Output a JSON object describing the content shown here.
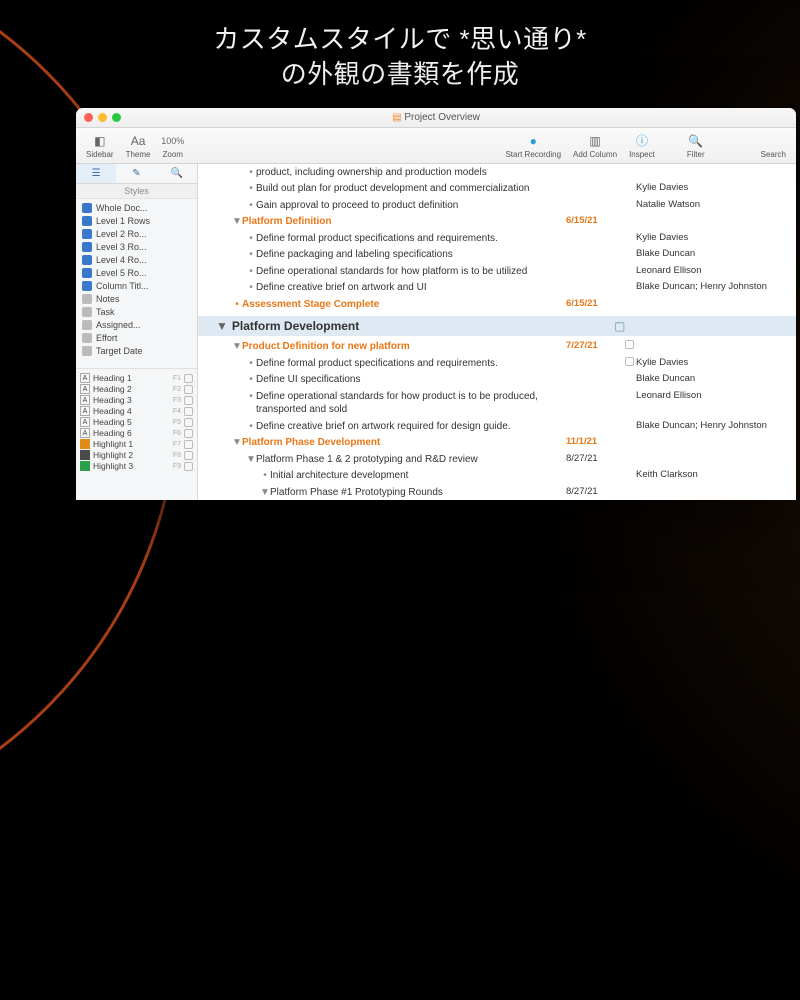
{
  "headline_line1": "カスタムスタイルで *思い通り*",
  "headline_line2": "の外観の書類を作成",
  "window": {
    "title": "Project Overview"
  },
  "toolbar": {
    "sidebar": "Sidebar",
    "theme": "Theme",
    "zoom_pct": "100%",
    "zoom": "Zoom",
    "start_rec": "Start Recording",
    "add_col": "Add Column",
    "inspect": "Inspect",
    "filter": "Filter",
    "search": "Search"
  },
  "sidebar": {
    "styles_header": "Styles",
    "styles": [
      {
        "label": "Whole Doc...",
        "blue": true
      },
      {
        "label": "Level 1 Rows",
        "blue": true
      },
      {
        "label": "Level 2 Ro...",
        "blue": true
      },
      {
        "label": "Level 3 Ro...",
        "blue": true
      },
      {
        "label": "Level 4 Ro...",
        "blue": true
      },
      {
        "label": "Level 5 Ro...",
        "blue": true
      },
      {
        "label": "Column Titl...",
        "blue": true
      },
      {
        "label": "Notes",
        "blue": false
      },
      {
        "label": "Task",
        "blue": false
      },
      {
        "label": "Assigned...",
        "blue": false
      },
      {
        "label": "Effort",
        "blue": false
      },
      {
        "label": "Target Date",
        "blue": false
      }
    ],
    "formats": [
      {
        "label": "Heading 1",
        "key": "F1",
        "type": "H"
      },
      {
        "label": "Heading 2",
        "key": "F2",
        "type": "H"
      },
      {
        "label": "Heading 3",
        "key": "F3",
        "type": "H"
      },
      {
        "label": "Heading 4",
        "key": "F4",
        "type": "H"
      },
      {
        "label": "Heading 5",
        "key": "F5",
        "type": "H"
      },
      {
        "label": "Heading 6",
        "key": "F6",
        "type": "H"
      },
      {
        "label": "Highlight 1",
        "key": "F7",
        "type": "HL",
        "color": "#e08a1a"
      },
      {
        "label": "Highlight 2",
        "key": "F8",
        "type": "HL",
        "color": "#4a4a4a"
      },
      {
        "label": "Highlight 3",
        "key": "F9",
        "type": "HL",
        "color": "#2aa04a"
      }
    ]
  },
  "outline": {
    "section_title": "Platform Development",
    "rows": [
      {
        "indent": 1,
        "type": "bullet",
        "text": "product, including ownership and production models",
        "date": "",
        "assignee": ""
      },
      {
        "indent": 1,
        "type": "bullet",
        "text": "Build out plan for product development and commercialization",
        "date": "",
        "assignee": "Kylie Davies"
      },
      {
        "indent": 1,
        "type": "bullet",
        "text": "Gain approval to proceed to product definition",
        "date": "",
        "assignee": "Natalie Watson"
      },
      {
        "indent": 0,
        "type": "tri",
        "orange": true,
        "text": "Platform Definition",
        "date": "6/15/21",
        "assignee": ""
      },
      {
        "indent": 1,
        "type": "bullet",
        "text": "Define formal product specifications and requirements.",
        "date": "",
        "assignee": "Kylie Davies"
      },
      {
        "indent": 1,
        "type": "bullet",
        "text": "Define packaging and labeling specifications",
        "date": "",
        "assignee": "Blake Duncan"
      },
      {
        "indent": 1,
        "type": "bullet",
        "text": "Define operational standards for how platform is to be utilized",
        "date": "",
        "assignee": "Leonard Ellison"
      },
      {
        "indent": 1,
        "type": "bullet",
        "text": "Define creative brief on artwork and UI",
        "date": "",
        "assignee": "Blake Duncan; Henry Johnston"
      },
      {
        "indent": 0,
        "type": "dot",
        "orange": true,
        "text": "Assessment Stage Complete",
        "date": "6/15/21",
        "assignee": ""
      }
    ],
    "rows2": [
      {
        "indent": 0,
        "type": "tri",
        "orange": true,
        "text": "Product Definition for new platform",
        "date": "7/27/21",
        "assignee": "",
        "check": true
      },
      {
        "indent": 1,
        "type": "bullet",
        "text": "Define formal product specifications and requirements.",
        "date": "",
        "assignee": "Kylie Davies",
        "check": true
      },
      {
        "indent": 1,
        "type": "bullet",
        "text": "Define UI specifications",
        "date": "",
        "assignee": "Blake Duncan"
      },
      {
        "indent": 1,
        "type": "bullet",
        "text": "Define operational standards for how product is to be produced, transported and sold",
        "date": "",
        "assignee": "Leonard Ellison"
      },
      {
        "indent": 1,
        "type": "bullet",
        "text": "Define creative brief on artwork required for design guide.",
        "date": "",
        "assignee": "Blake Duncan; Henry Johnston"
      },
      {
        "indent": 0,
        "type": "tri",
        "orange": true,
        "text": "Platform Phase Development",
        "date": "11/1/21",
        "assignee": ""
      },
      {
        "indent": 1,
        "type": "tri",
        "text": "Platform Phase 1 & 2 prototyping and R&D review",
        "date": "8/27/21",
        "assignee": ""
      },
      {
        "indent": 2,
        "type": "bullet",
        "text": "Initial architecture development",
        "date": "",
        "assignee": "Keith Clarkson"
      },
      {
        "indent": 2,
        "type": "tri",
        "text": "Platform Phase #1 Prototyping Rounds",
        "date": "8/27/21",
        "assignee": ""
      }
    ]
  }
}
